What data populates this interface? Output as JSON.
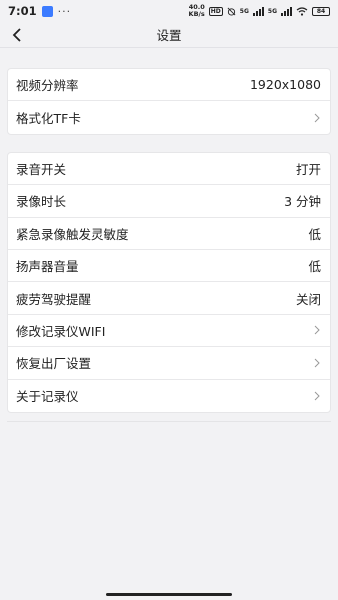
{
  "statusbar": {
    "time": "7:01",
    "dots": "···",
    "net_speed_top": "40.0",
    "net_speed_bottom": "KB/s",
    "hd_tag": "HD",
    "signal1_label": "5G",
    "signal2_label": "5G",
    "battery": "84"
  },
  "header": {
    "title": "设置",
    "back_icon": "chevron-left-icon"
  },
  "group1": [
    {
      "label": "视频分辨率",
      "value": "1920x1080",
      "chevron": false
    },
    {
      "label": "格式化TF卡",
      "value": "",
      "chevron": true
    }
  ],
  "group2": [
    {
      "label": "录音开关",
      "value": "打开",
      "chevron": false
    },
    {
      "label": "录像时长",
      "value": "3 分钟",
      "chevron": false
    },
    {
      "label": "紧急录像触发灵敏度",
      "value": "低",
      "chevron": false
    },
    {
      "label": "扬声器音量",
      "value": "低",
      "chevron": false
    },
    {
      "label": "疲劳驾驶提醒",
      "value": "关闭",
      "chevron": false
    },
    {
      "label": "修改记录仪WIFI",
      "value": "",
      "chevron": true
    },
    {
      "label": "恢复出厂设置",
      "value": "",
      "chevron": true
    },
    {
      "label": "关于记录仪",
      "value": "",
      "chevron": true
    }
  ],
  "colors": {
    "background": "#f2f2f4",
    "card": "#ffffff",
    "text": "#222222"
  }
}
